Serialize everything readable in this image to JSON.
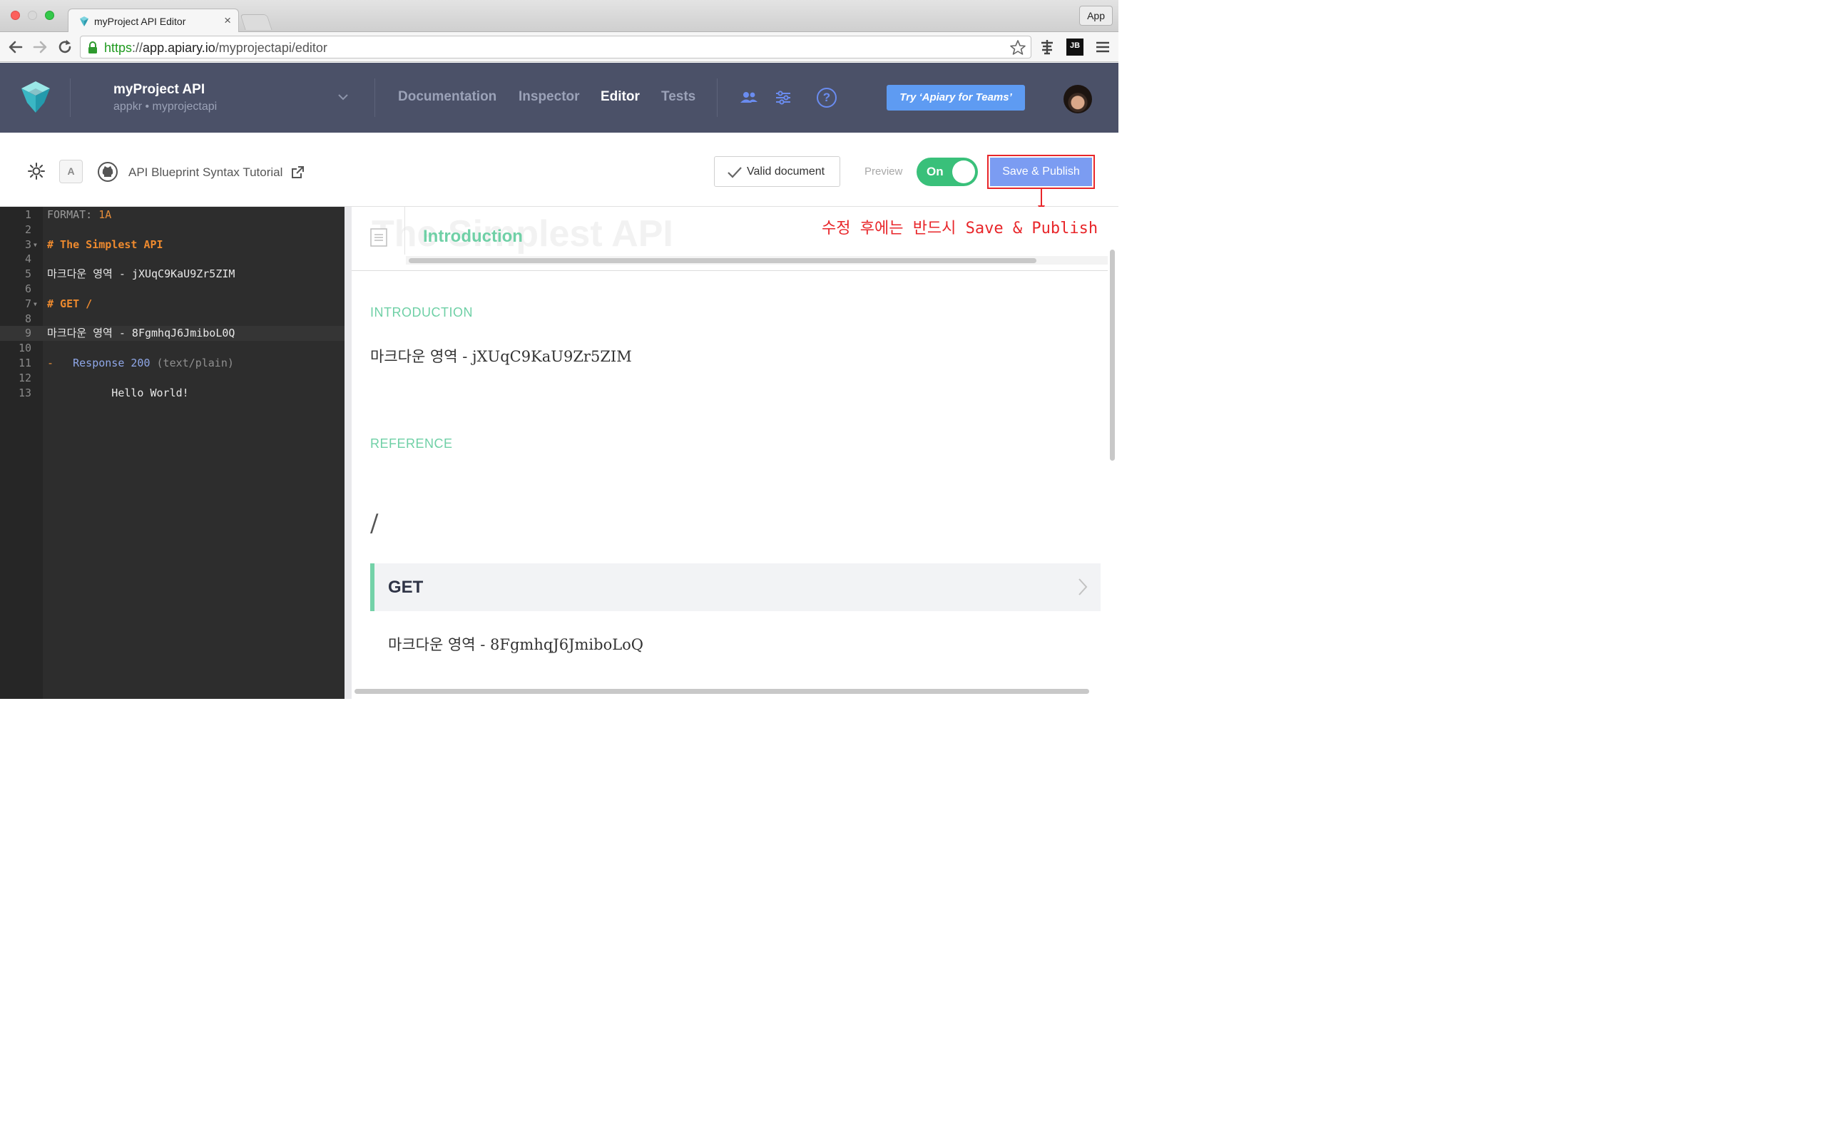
{
  "browser": {
    "tab_title": "myProject API Editor",
    "tab_close": "×",
    "app_button": "App",
    "url_scheme": "https",
    "url_sep": "://",
    "url_host": "app.apiary.io",
    "url_path": "/myprojectapi/editor",
    "ext_jb_label": "JB"
  },
  "header": {
    "project_name": "myProject API",
    "project_sub": "appkr • myprojectapi",
    "nav": [
      "Documentation",
      "Inspector",
      "Editor",
      "Tests"
    ],
    "active_nav": "Editor",
    "teams_button": "Try ‘Apiary for Teams’",
    "help_icon_label": "?"
  },
  "editor_toolbar": {
    "font_button": "A",
    "tutorial_link": "API Blueprint Syntax Tutorial",
    "valid_label": "Valid document",
    "preview_label": "Preview",
    "preview_toggle": "On",
    "publish_button": "Save & Publish",
    "annotation": "수정 후에는 반드시 Save & Publish"
  },
  "code": {
    "active_line": 9,
    "lines": [
      {
        "n": "1",
        "parts": [
          [
            "c-meta",
            "FORMAT: "
          ],
          [
            "c-num",
            "1A"
          ]
        ]
      },
      {
        "n": "2",
        "parts": []
      },
      {
        "n": "3",
        "fold": true,
        "parts": [
          [
            "c-head",
            "# The Simplest API"
          ]
        ]
      },
      {
        "n": "4",
        "parts": []
      },
      {
        "n": "5",
        "parts": [
          [
            "",
            "마크다운 영역 - jXUqC9KaU9Zr5ZIM"
          ]
        ]
      },
      {
        "n": "6",
        "parts": []
      },
      {
        "n": "7",
        "fold": true,
        "parts": [
          [
            "c-head",
            "# GET /"
          ]
        ]
      },
      {
        "n": "8",
        "parts": []
      },
      {
        "n": "9",
        "parts": [
          [
            "",
            "마크다운 영역 - 8FgmhqJ6JmiboL0Q"
          ]
        ]
      },
      {
        "n": "10",
        "parts": []
      },
      {
        "n": "11",
        "parts": [
          [
            "c-num",
            "-"
          ],
          [
            "",
            "   "
          ],
          [
            "c-kw",
            "Response 200"
          ],
          [
            "",
            " "
          ],
          [
            "c-muted",
            "(text/plain)"
          ]
        ]
      },
      {
        "n": "12",
        "parts": []
      },
      {
        "n": "13",
        "parts": [
          [
            "",
            "          Hello World!"
          ]
        ]
      }
    ]
  },
  "preview": {
    "ghost_title": "The Simplest API",
    "toc_item": "Introduction",
    "introduction_heading": "INTRODUCTION",
    "intro_text": "마크다운 영역 - jXUqC9KaU9Zr5ZIM",
    "reference_heading": "REFERENCE",
    "resource_path": "/",
    "method": "GET",
    "method_text": "마크다운 영역 - 8FgmhqJ6JmiboLoQ"
  },
  "colors": {
    "header_bg": "#4b5168",
    "accent_green": "#6fd0a6",
    "publish_blue": "#7b9cf2",
    "annotation_red": "#e8262a"
  },
  "icons": [
    "apiary-logo-icon",
    "lock-icon",
    "star-icon",
    "back-arrow-icon",
    "forward-arrow-icon",
    "reload-icon",
    "users-icon",
    "settings-sliders-icon",
    "help-icon",
    "sun-icon",
    "github-icon",
    "external-link-icon",
    "check-icon",
    "toc-icon",
    "chevron-right-icon"
  ]
}
